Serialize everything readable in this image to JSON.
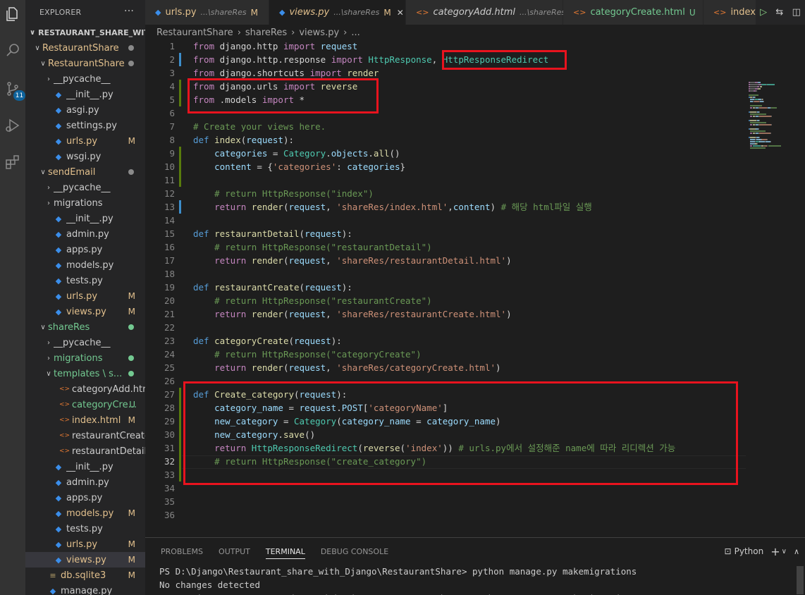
{
  "activity_bar": {
    "icons": [
      "files-icon",
      "search-icon",
      "source-control-icon",
      "run-debug-icon",
      "extensions-icon"
    ],
    "source_control_badge": "11"
  },
  "sidebar": {
    "title": "EXPLORER",
    "more": "···",
    "root": "RESTAURANT_SHARE_WIT...",
    "items": [
      {
        "label": "RestaurantShare",
        "depth": 0,
        "type": "folder-open",
        "color": "mod",
        "dot": "#8a8a8a"
      },
      {
        "label": "RestaurantShare",
        "depth": 1,
        "type": "folder-open",
        "color": "mod",
        "dot": "#8a8a8a"
      },
      {
        "label": "__pycache__",
        "depth": 2,
        "type": "folder-closed",
        "color": "plain"
      },
      {
        "label": "__init__.py",
        "depth": 2,
        "type": "py",
        "color": "plain"
      },
      {
        "label": "asgi.py",
        "depth": 2,
        "type": "py",
        "color": "plain"
      },
      {
        "label": "settings.py",
        "depth": 2,
        "type": "py",
        "color": "plain"
      },
      {
        "label": "urls.py",
        "depth": 2,
        "type": "py",
        "color": "mod",
        "status": "M"
      },
      {
        "label": "wsgi.py",
        "depth": 2,
        "type": "py",
        "color": "plain"
      },
      {
        "label": "sendEmail",
        "depth": 1,
        "type": "folder-open",
        "color": "mod",
        "dot": "#8a8a8a"
      },
      {
        "label": "__pycache__",
        "depth": 2,
        "type": "folder-closed",
        "color": "plain"
      },
      {
        "label": "migrations",
        "depth": 2,
        "type": "folder-closed",
        "color": "plain"
      },
      {
        "label": "__init__.py",
        "depth": 2,
        "type": "py",
        "color": "plain"
      },
      {
        "label": "admin.py",
        "depth": 2,
        "type": "py",
        "color": "plain"
      },
      {
        "label": "apps.py",
        "depth": 2,
        "type": "py",
        "color": "plain"
      },
      {
        "label": "models.py",
        "depth": 2,
        "type": "py",
        "color": "plain"
      },
      {
        "label": "tests.py",
        "depth": 2,
        "type": "py",
        "color": "plain"
      },
      {
        "label": "urls.py",
        "depth": 2,
        "type": "py",
        "color": "mod",
        "status": "M"
      },
      {
        "label": "views.py",
        "depth": 2,
        "type": "py",
        "color": "mod",
        "status": "M"
      },
      {
        "label": "shareRes",
        "depth": 1,
        "type": "folder-open",
        "color": "untracked",
        "dot": "#73c991"
      },
      {
        "label": "__pycache__",
        "depth": 2,
        "type": "folder-closed",
        "color": "plain"
      },
      {
        "label": "migrations",
        "depth": 2,
        "type": "folder-closed",
        "color": "untracked",
        "dot": "#73c991"
      },
      {
        "label": "templates \\ s...",
        "depth": 2,
        "type": "folder-open",
        "color": "untracked",
        "dot": "#73c991"
      },
      {
        "label": "categoryAdd.html",
        "depth": 3,
        "type": "html",
        "color": "plain"
      },
      {
        "label": "categoryCre...",
        "depth": 3,
        "type": "html",
        "color": "untracked",
        "status": "U"
      },
      {
        "label": "index.html",
        "depth": 3,
        "type": "html",
        "color": "mod",
        "status": "M"
      },
      {
        "label": "restaurantCreate....",
        "depth": 3,
        "type": "html",
        "color": "plain"
      },
      {
        "label": "restaurantDetail.h...",
        "depth": 3,
        "type": "html",
        "color": "plain"
      },
      {
        "label": "__init__.py",
        "depth": 2,
        "type": "py",
        "color": "plain"
      },
      {
        "label": "admin.py",
        "depth": 2,
        "type": "py",
        "color": "plain"
      },
      {
        "label": "apps.py",
        "depth": 2,
        "type": "py",
        "color": "plain"
      },
      {
        "label": "models.py",
        "depth": 2,
        "type": "py",
        "color": "mod",
        "status": "M"
      },
      {
        "label": "tests.py",
        "depth": 2,
        "type": "py",
        "color": "plain"
      },
      {
        "label": "urls.py",
        "depth": 2,
        "type": "py",
        "color": "mod",
        "status": "M"
      },
      {
        "label": "views.py",
        "depth": 2,
        "type": "py",
        "color": "mod",
        "status": "M",
        "selected": true
      },
      {
        "label": "db.sqlite3",
        "depth": 1,
        "type": "db",
        "color": "mod",
        "status": "M"
      },
      {
        "label": "manage.py",
        "depth": 1,
        "type": "py",
        "color": "plain"
      }
    ]
  },
  "tabs": [
    {
      "name": "urls.py",
      "desc": "...\\shareRes",
      "status": "M",
      "icon": "py",
      "color": "mod"
    },
    {
      "name": "views.py",
      "desc": "...\\shareRes",
      "status": "M",
      "icon": "py",
      "color": "mod",
      "active": true,
      "close": "✕"
    },
    {
      "name": "categoryAdd.html",
      "desc": "...\\shareRes",
      "status": "",
      "icon": "html",
      "color": "plain"
    },
    {
      "name": "categoryCreate.html",
      "desc": "",
      "status": "U",
      "icon": "html",
      "color": "untracked"
    },
    {
      "name": "index.h",
      "desc": "",
      "status": "",
      "icon": "html",
      "color": "mod"
    }
  ],
  "breadcrumb": [
    "RestaurantShare",
    "›",
    "shareRes",
    "›",
    "views.py",
    "›",
    "..."
  ],
  "code_lines": [
    [
      [
        "kw",
        "from"
      ],
      [
        "pl",
        " django.http "
      ],
      [
        "kw",
        "import"
      ],
      [
        "pl",
        " "
      ],
      [
        "var",
        "request"
      ]
    ],
    [
      [
        "kw",
        "from"
      ],
      [
        "pl",
        " django.http.response "
      ],
      [
        "kw",
        "import"
      ],
      [
        "pl",
        " "
      ],
      [
        "cls",
        "HttpResponse"
      ],
      [
        "pl",
        ", "
      ],
      [
        "cls",
        "HttpResponseRedirect"
      ]
    ],
    [
      [
        "kw",
        "from"
      ],
      [
        "pl",
        " django.shortcuts "
      ],
      [
        "kw",
        "import"
      ],
      [
        "pl",
        " "
      ],
      [
        "fn",
        "render"
      ]
    ],
    [
      [
        "kw",
        "from"
      ],
      [
        "pl",
        " django.urls "
      ],
      [
        "kw",
        "import"
      ],
      [
        "pl",
        " "
      ],
      [
        "fn",
        "reverse"
      ]
    ],
    [
      [
        "kw",
        "from"
      ],
      [
        "pl",
        " .models "
      ],
      [
        "kw",
        "import"
      ],
      [
        "pl",
        " *"
      ]
    ],
    [],
    [
      [
        "cm",
        "# Create your views here."
      ]
    ],
    [
      [
        "kd",
        "def"
      ],
      [
        "pl",
        " "
      ],
      [
        "fn",
        "index"
      ],
      [
        "pl",
        "("
      ],
      [
        "var",
        "request"
      ],
      [
        "pl",
        "):"
      ]
    ],
    [
      [
        "pl",
        "    "
      ],
      [
        "var",
        "categories"
      ],
      [
        "pl",
        " = "
      ],
      [
        "cls",
        "Category"
      ],
      [
        "pl",
        "."
      ],
      [
        "var",
        "objects"
      ],
      [
        "pl",
        "."
      ],
      [
        "fn",
        "all"
      ],
      [
        "pl",
        "()"
      ]
    ],
    [
      [
        "pl",
        "    "
      ],
      [
        "var",
        "content"
      ],
      [
        "pl",
        " = {"
      ],
      [
        "str",
        "'categories'"
      ],
      [
        "pl",
        ": "
      ],
      [
        "var",
        "categories"
      ],
      [
        "pl",
        "}"
      ]
    ],
    [],
    [
      [
        "pl",
        "    "
      ],
      [
        "cm",
        "# return HttpResponse(\"index\")"
      ]
    ],
    [
      [
        "pl",
        "    "
      ],
      [
        "kw",
        "return"
      ],
      [
        "pl",
        " "
      ],
      [
        "fn",
        "render"
      ],
      [
        "pl",
        "("
      ],
      [
        "var",
        "request"
      ],
      [
        "pl",
        ", "
      ],
      [
        "str",
        "'shareRes/index.html'"
      ],
      [
        "pl",
        ","
      ],
      [
        "var",
        "content"
      ],
      [
        "pl",
        ") "
      ],
      [
        "cm",
        "# 해당 html파일 실행"
      ]
    ],
    [],
    [
      [
        "kd",
        "def"
      ],
      [
        "pl",
        " "
      ],
      [
        "fn",
        "restaurantDetail"
      ],
      [
        "pl",
        "("
      ],
      [
        "var",
        "request"
      ],
      [
        "pl",
        "):"
      ]
    ],
    [
      [
        "pl",
        "    "
      ],
      [
        "cm",
        "# return HttpResponse(\"restaurantDetail\")"
      ]
    ],
    [
      [
        "pl",
        "    "
      ],
      [
        "kw",
        "return"
      ],
      [
        "pl",
        " "
      ],
      [
        "fn",
        "render"
      ],
      [
        "pl",
        "("
      ],
      [
        "var",
        "request"
      ],
      [
        "pl",
        ", "
      ],
      [
        "str",
        "'shareRes/restaurantDetail.html'"
      ],
      [
        "pl",
        ")"
      ]
    ],
    [],
    [
      [
        "kd",
        "def"
      ],
      [
        "pl",
        " "
      ],
      [
        "fn",
        "restaurantCreate"
      ],
      [
        "pl",
        "("
      ],
      [
        "var",
        "request"
      ],
      [
        "pl",
        "):"
      ]
    ],
    [
      [
        "pl",
        "    "
      ],
      [
        "cm",
        "# return HttpResponse(\"restaurantCreate\")"
      ]
    ],
    [
      [
        "pl",
        "    "
      ],
      [
        "kw",
        "return"
      ],
      [
        "pl",
        " "
      ],
      [
        "fn",
        "render"
      ],
      [
        "pl",
        "("
      ],
      [
        "var",
        "request"
      ],
      [
        "pl",
        ", "
      ],
      [
        "str",
        "'shareRes/restaurantCreate.html'"
      ],
      [
        "pl",
        ")"
      ]
    ],
    [],
    [
      [
        "kd",
        "def"
      ],
      [
        "pl",
        " "
      ],
      [
        "fn",
        "categoryCreate"
      ],
      [
        "pl",
        "("
      ],
      [
        "var",
        "request"
      ],
      [
        "pl",
        "):"
      ]
    ],
    [
      [
        "pl",
        "    "
      ],
      [
        "cm",
        "# return HttpResponse(\"categoryCreate\")"
      ]
    ],
    [
      [
        "pl",
        "    "
      ],
      [
        "kw",
        "return"
      ],
      [
        "pl",
        " "
      ],
      [
        "fn",
        "render"
      ],
      [
        "pl",
        "("
      ],
      [
        "var",
        "request"
      ],
      [
        "pl",
        ", "
      ],
      [
        "str",
        "'shareRes/categoryCreate.html'"
      ],
      [
        "pl",
        ")"
      ]
    ],
    [],
    [
      [
        "kd",
        "def"
      ],
      [
        "pl",
        " "
      ],
      [
        "fn",
        "Create_category"
      ],
      [
        "pl",
        "("
      ],
      [
        "var",
        "request"
      ],
      [
        "pl",
        "):"
      ]
    ],
    [
      [
        "pl",
        "    "
      ],
      [
        "var",
        "category_name"
      ],
      [
        "pl",
        " = "
      ],
      [
        "var",
        "request"
      ],
      [
        "pl",
        "."
      ],
      [
        "var",
        "POST"
      ],
      [
        "pl",
        "["
      ],
      [
        "str",
        "'categoryName'"
      ],
      [
        "pl",
        "]"
      ]
    ],
    [
      [
        "pl",
        "    "
      ],
      [
        "var",
        "new_category"
      ],
      [
        "pl",
        " = "
      ],
      [
        "cls",
        "Category"
      ],
      [
        "pl",
        "("
      ],
      [
        "var",
        "category_name"
      ],
      [
        "pl",
        " = "
      ],
      [
        "var",
        "category_name"
      ],
      [
        "pl",
        ")"
      ]
    ],
    [
      [
        "pl",
        "    "
      ],
      [
        "var",
        "new_category"
      ],
      [
        "pl",
        "."
      ],
      [
        "fn",
        "save"
      ],
      [
        "pl",
        "()"
      ]
    ],
    [
      [
        "pl",
        "    "
      ],
      [
        "kw",
        "return"
      ],
      [
        "pl",
        " "
      ],
      [
        "cls",
        "HttpResponseRedirect"
      ],
      [
        "pl",
        "("
      ],
      [
        "fn",
        "reverse"
      ],
      [
        "pl",
        "("
      ],
      [
        "str",
        "'index'"
      ],
      [
        "pl",
        "))"
      ],
      [
        "pl",
        " "
      ],
      [
        "cm",
        "# urls.py에서 설정해준 name에 따라 리디렉션 가능"
      ]
    ],
    [
      [
        "pl",
        "    "
      ],
      [
        "cm",
        "# return HttpResponse(\"create_category\")"
      ]
    ],
    [],
    [],
    [],
    []
  ],
  "current_line": 32,
  "panel": {
    "tabs": [
      "PROBLEMS",
      "OUTPUT",
      "TERMINAL",
      "DEBUG CONSOLE"
    ],
    "active_tab": "TERMINAL",
    "shell": "Python",
    "add": "+",
    "dropdown": "∨",
    "collapse": "∧",
    "terminal_lines": [
      "PS D:\\Django\\Restaurant_share_with_Django\\RestaurantShare> python manage.py makemigrations",
      "No changes detected",
      "PS D:\\Django\\Restaurant_share_with_Django\\RestaurantShare> python manage.py makemigrations"
    ]
  },
  "colors": {
    "modified": "#e2c08d",
    "untracked": "#73c991",
    "annotation_red": "#e8131e",
    "accent": "#0e639c"
  }
}
